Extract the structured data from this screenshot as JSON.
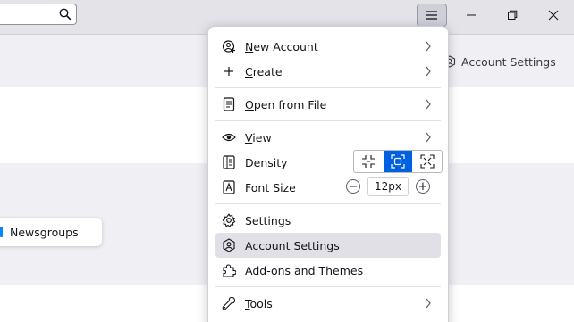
{
  "titlebar": {
    "search": {
      "value": ""
    },
    "window_controls": [
      "minimize-icon",
      "restore-icon",
      "close-icon"
    ],
    "app_menu_icon": "hamburger-icon"
  },
  "background": {
    "account_settings_label": "Account Settings",
    "newsgroups_label": "Newsgroups"
  },
  "menu": {
    "new_account": {
      "prefix": "",
      "accel": "N",
      "rest": "ew Account",
      "icon": "new-account-icon"
    },
    "create": {
      "accel": "C",
      "rest": "reate",
      "icon": "plus-icon"
    },
    "open_from_file": {
      "accel": "O",
      "rest": "pen from File",
      "icon": "file-icon"
    },
    "view": {
      "accel": "V",
      "rest": "iew",
      "icon": "eye-icon"
    },
    "density": {
      "label": "Density",
      "icon": "density-icon",
      "options": [
        "compact",
        "normal",
        "touch"
      ],
      "selected": "normal"
    },
    "font_size": {
      "label": "Font Size",
      "value": "12px",
      "icon": "font-size-icon",
      "minus": "−",
      "plus": "+"
    },
    "settings": {
      "label": "Settings",
      "icon": "gear-icon"
    },
    "account_settings": {
      "label": "Account Settings",
      "icon": "account-settings-icon"
    },
    "addons": {
      "label": "Add-ons and Themes",
      "icon": "puzzle-icon"
    },
    "tools": {
      "accel": "T",
      "rest": "ools",
      "icon": "wrench-icon"
    }
  },
  "colors": {
    "accent": "#0061e0",
    "hover": "#e0e0e6",
    "titlebar": "#e3e3e8"
  }
}
